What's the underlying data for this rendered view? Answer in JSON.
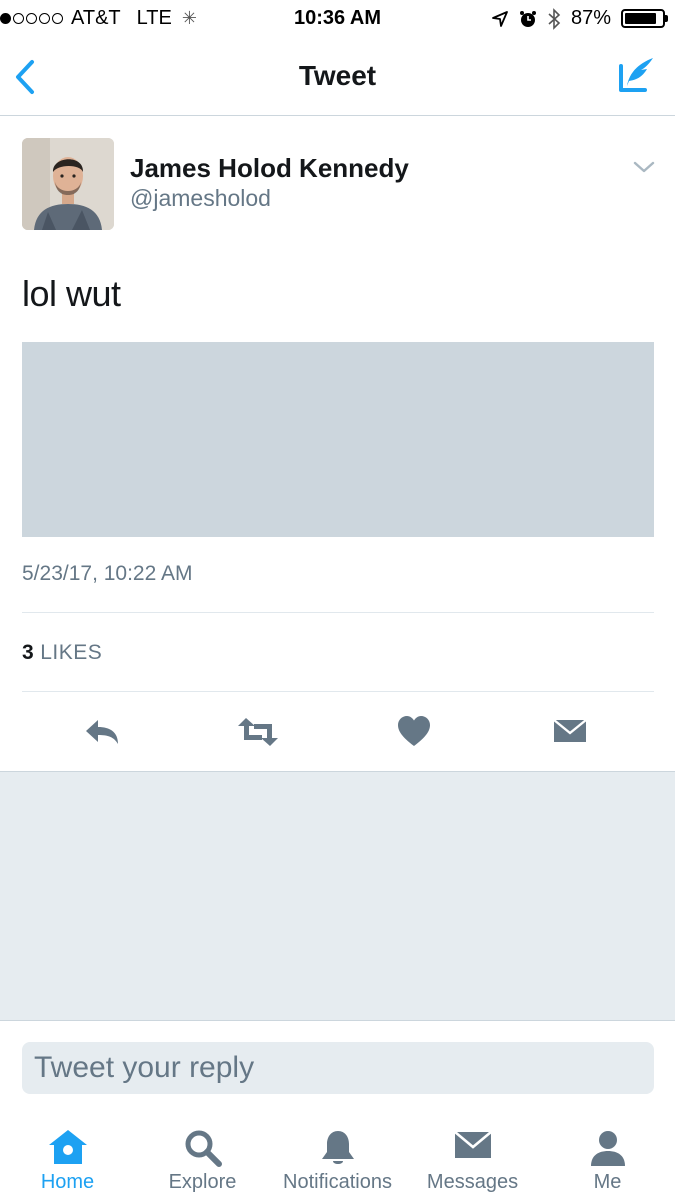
{
  "status_bar": {
    "carrier": "AT&T",
    "network": "LTE",
    "time": "10:36 AM",
    "battery": "87%",
    "battery_level": 0.87,
    "signal_bars": 1
  },
  "nav": {
    "title": "Tweet"
  },
  "tweet": {
    "user_name": "James Holod Kennedy",
    "user_handle": "@jamesholod",
    "text": "lol wut",
    "timestamp": "5/23/17, 10:22 AM",
    "likes_count": "3",
    "likes_label": "LIKES"
  },
  "reply": {
    "placeholder": "Tweet your reply"
  },
  "tabs": [
    {
      "label": "Home",
      "icon": "home-icon"
    },
    {
      "label": "Explore",
      "icon": "search-icon"
    },
    {
      "label": "Notifications",
      "icon": "bell-icon"
    },
    {
      "label": "Messages",
      "icon": "envelope-icon"
    },
    {
      "label": "Me",
      "icon": "person-icon"
    }
  ],
  "colors": {
    "accent": "#1da1f2",
    "icon_gray": "#657786",
    "divider": "#e1e8ed",
    "background_gray": "#e6ecf0",
    "media_placeholder": "#ccd6dd"
  }
}
